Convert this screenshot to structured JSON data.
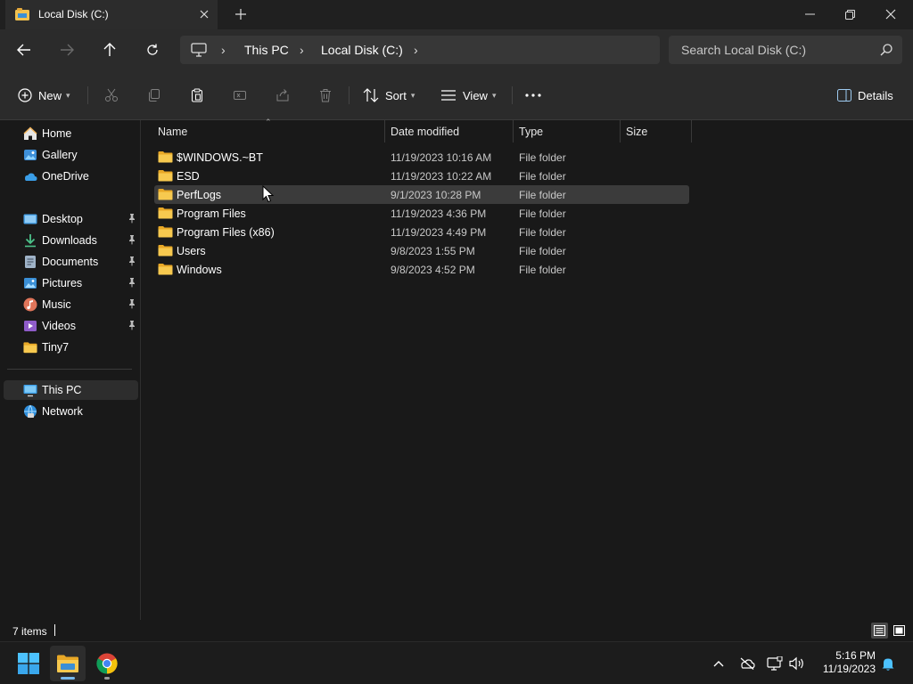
{
  "window": {
    "tab_title": "Local Disk (C:)",
    "new_tab_label": "+"
  },
  "address": {
    "breadcrumb": [
      "This PC",
      "Local Disk (C:)"
    ],
    "search_placeholder": "Search Local Disk (C:)"
  },
  "toolbar": {
    "new_label": "New",
    "sort_label": "Sort",
    "view_label": "View",
    "more_label": "···",
    "details_label": "Details"
  },
  "nav": {
    "home": "Home",
    "gallery": "Gallery",
    "onedrive": "OneDrive",
    "desktop": "Desktop",
    "downloads": "Downloads",
    "documents": "Documents",
    "pictures": "Pictures",
    "music": "Music",
    "videos": "Videos",
    "tiny7": "Tiny7",
    "this_pc": "This PC",
    "network": "Network"
  },
  "columns": {
    "name": "Name",
    "date": "Date modified",
    "type": "Type",
    "size": "Size"
  },
  "files": [
    {
      "name": "$WINDOWS.~BT",
      "date": "11/19/2023 10:16 AM",
      "type": "File folder"
    },
    {
      "name": "ESD",
      "date": "11/19/2023 10:22 AM",
      "type": "File folder"
    },
    {
      "name": "PerfLogs",
      "date": "9/1/2023 10:28 PM",
      "type": "File folder"
    },
    {
      "name": "Program Files",
      "date": "11/19/2023 4:36 PM",
      "type": "File folder"
    },
    {
      "name": "Program Files (x86)",
      "date": "11/19/2023 4:49 PM",
      "type": "File folder"
    },
    {
      "name": "Users",
      "date": "9/8/2023 1:55 PM",
      "type": "File folder"
    },
    {
      "name": "Windows",
      "date": "9/8/2023 4:52 PM",
      "type": "File folder"
    }
  ],
  "status": {
    "item_count": "7 items"
  },
  "taskbar": {
    "time": "5:16 PM",
    "date": "11/19/2023"
  },
  "colors": {
    "folder": "#f2c14e",
    "accent": "#76b9ed"
  }
}
